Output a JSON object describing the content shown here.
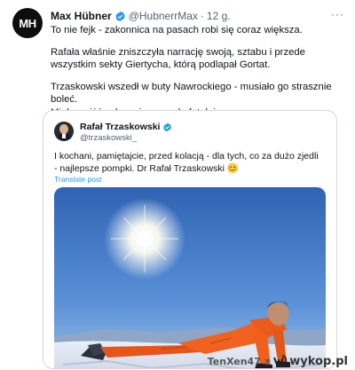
{
  "tweet": {
    "avatar_initials": "MH",
    "author_name": "Max Hübner",
    "handle": "@HubnerrMax",
    "separator": "·",
    "time": "12 g.",
    "more_label": "···",
    "paragraphs": [
      "To nie fejk - zakonnica na pasach robi się coraz większa.",
      "Rafała właśnie zniszczyła narrację swoją, sztabu i przede wszystkim sekty Giertycha, którą podlapał Gortat.",
      "Trzaskowski wszedł w buty Nawrockiego - musiało go strasznie boleć.\nMiało wyjść zabawnie - wyszło fatalnie."
    ]
  },
  "quote": {
    "author_name": "Rafał Trzaskowski",
    "handle": "@trzaskowski_",
    "text": "I kochani, pamiętajcie, przed kolacją - dla tych, co za dużo zjedli - najlepsze pompki. Dr Rafał Trzaskowski 😊",
    "translate_label": "Translate post"
  },
  "watermark": {
    "user": "TenXen47",
    "z": "z",
    "site": "wykop.pl"
  },
  "colors": {
    "verified_blue": "#1d9bf0",
    "jacket_orange": "#f0631f",
    "sky_blue": "#3f79c6"
  },
  "icons": [
    "verified-badge-icon",
    "more-icon",
    "wykop-logo-icon"
  ]
}
